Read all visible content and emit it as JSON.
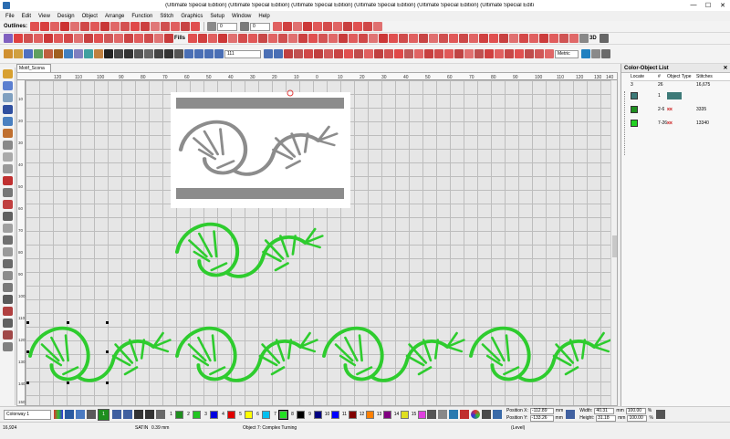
{
  "window": {
    "title": "(Ultimate Special Edition) (Ultimate Special Edition) (Ultimate Special Edition) (Ultimate Special Edition) (Ultimate Special Edition) (Ultimate Special Editi",
    "controls": [
      "—",
      "☐",
      "✕"
    ]
  },
  "menu": [
    "File",
    "Edit",
    "View",
    "Design",
    "Object",
    "Arrange",
    "Function",
    "Stitch",
    "Graphics",
    "Setup",
    "Window",
    "Help"
  ],
  "toolbar1": {
    "label": "Outlines:",
    "spin_value": "0",
    "spin2_value": "0"
  },
  "toolbar2": {
    "fills_label": "Fills",
    "badge_3d": "3D"
  },
  "toolbar3": {
    "zoom_value": "111",
    "units_value": "Metric"
  },
  "document": {
    "tab_label": "Motif_Scona"
  },
  "ruler": {
    "h_ticks": [
      "120",
      "110",
      "100",
      "90",
      "80",
      "70",
      "60",
      "50",
      "40",
      "30",
      "20",
      "10",
      "0",
      "10",
      "20",
      "30",
      "40",
      "50",
      "60",
      "70",
      "80",
      "90",
      "100",
      "110",
      "120",
      "130",
      "140"
    ],
    "v_ticks": [
      "10",
      "20",
      "30",
      "40",
      "50",
      "60",
      "70",
      "80",
      "90",
      "100",
      "110",
      "120",
      "130",
      "140",
      "150"
    ]
  },
  "color_object_list": {
    "title": "Color-Object List",
    "close": "✕",
    "columns": [
      "Locate",
      "#",
      "Object Type",
      "Stitches"
    ],
    "summary_row": {
      "locate": "3",
      "num": "26",
      "stitches": "16,675"
    },
    "rows": [
      {
        "color": "#3d7a78",
        "num": "1",
        "stitches": ""
      },
      {
        "color": "#1f8f1f",
        "num": "2-6",
        "stitches": "3335"
      },
      {
        "color": "#22d122",
        "num": "7-26",
        "stitches": "13340"
      }
    ]
  },
  "bottom_toolbar": {
    "colorway": "Colorway 1",
    "current_color_num": "1",
    "current_color": "#1f8f1f",
    "palette": [
      {
        "num": "1",
        "color": "#1f8f1f"
      },
      {
        "num": "2",
        "color": "#22c522"
      },
      {
        "num": "3",
        "color": "#0000e0"
      },
      {
        "num": "4",
        "color": "#e00000"
      },
      {
        "num": "5",
        "color": "#ffff00"
      },
      {
        "num": "6",
        "color": "#00c0f0"
      },
      {
        "num": "7",
        "color": "#22e022"
      },
      {
        "num": "8",
        "color": "#000000"
      },
      {
        "num": "9",
        "color": "#000080"
      },
      {
        "num": "10",
        "color": "#0000ff"
      },
      {
        "num": "11",
        "color": "#800000"
      },
      {
        "num": "12",
        "color": "#ff8000"
      },
      {
        "num": "13",
        "color": "#800080"
      },
      {
        "num": "14",
        "color": "#e0e020"
      },
      {
        "num": "15",
        "color": "#e040e0"
      }
    ],
    "position_x_label": "Position X:",
    "position_x": "-112.89",
    "position_y_label": "Position Y:",
    "position_y": "-133.26",
    "width_label": "Width:",
    "width": "40.31",
    "height_label": "Height:",
    "height": "31.18",
    "unit": "mm",
    "pct_w": "100.00",
    "pct_h": "100.00",
    "pct_sign": "%"
  },
  "status": {
    "stitch_count": "16,924",
    "stitch_type": "SATIN",
    "stitch_length": "0.39 mm",
    "object_info": "Object 7: Complex Turning",
    "mode": "(Level)"
  }
}
